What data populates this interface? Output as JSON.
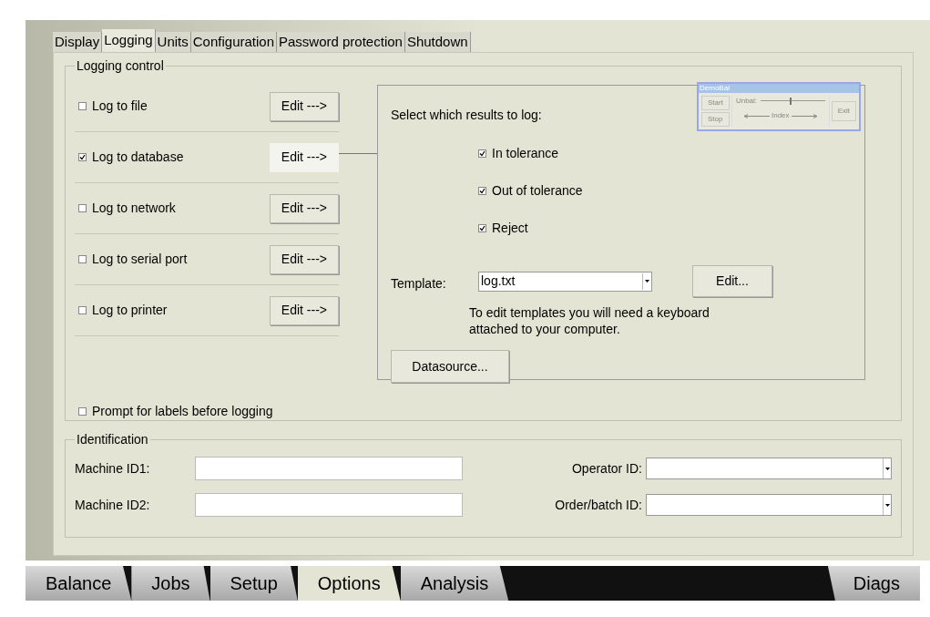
{
  "tabs": [
    {
      "label": "Display",
      "selected": false
    },
    {
      "label": "Logging",
      "selected": true
    },
    {
      "label": "Units",
      "selected": false
    },
    {
      "label": "Configuration",
      "selected": false
    },
    {
      "label": "Password protection",
      "selected": false
    },
    {
      "label": "Shutdown",
      "selected": false
    }
  ],
  "logging_control": {
    "title": "Logging control",
    "targets": [
      {
        "label": "Log to file",
        "checked": false,
        "button": "Edit --->",
        "selected": false
      },
      {
        "label": "Log to database",
        "checked": true,
        "button": "Edit --->",
        "selected": true
      },
      {
        "label": "Log to network",
        "checked": false,
        "button": "Edit --->",
        "selected": false
      },
      {
        "label": "Log to serial port",
        "checked": false,
        "button": "Edit --->",
        "selected": false
      },
      {
        "label": "Log to printer",
        "checked": false,
        "button": "Edit --->",
        "selected": false
      }
    ],
    "prompt": {
      "label": "Prompt for labels before logging",
      "checked": false
    },
    "results": {
      "heading": "Select which results to log:",
      "options": [
        {
          "label": "In tolerance",
          "checked": true
        },
        {
          "label": "Out of tolerance",
          "checked": true
        },
        {
          "label": "Reject",
          "checked": true
        }
      ]
    },
    "template": {
      "label": "Template:",
      "value": "log.txt",
      "button": "Edit...",
      "note": "To edit templates you will need a keyboard attached to your computer."
    },
    "datasource_button": "Datasource...",
    "preview": {
      "title": "DemoBal",
      "start": "Start",
      "stop": "Stop",
      "unbal": "Unbal:",
      "level": 0.45,
      "index": "Index",
      "exit": "Exit"
    }
  },
  "identification": {
    "title": "Identification",
    "fields": [
      {
        "label": "Machine ID1:",
        "kind": "text"
      },
      {
        "label": "Operator ID:",
        "kind": "combo"
      },
      {
        "label": "Machine ID2:",
        "kind": "text"
      },
      {
        "label": "Order/batch ID:",
        "kind": "combo"
      }
    ]
  },
  "nav_tabs": [
    {
      "label": "Balance",
      "selected": false
    },
    {
      "label": "Jobs",
      "selected": false
    },
    {
      "label": "Setup",
      "selected": false
    },
    {
      "label": "Options",
      "selected": true
    },
    {
      "label": "Analysis",
      "selected": false
    },
    {
      "label": "Diags",
      "selected": false
    }
  ]
}
